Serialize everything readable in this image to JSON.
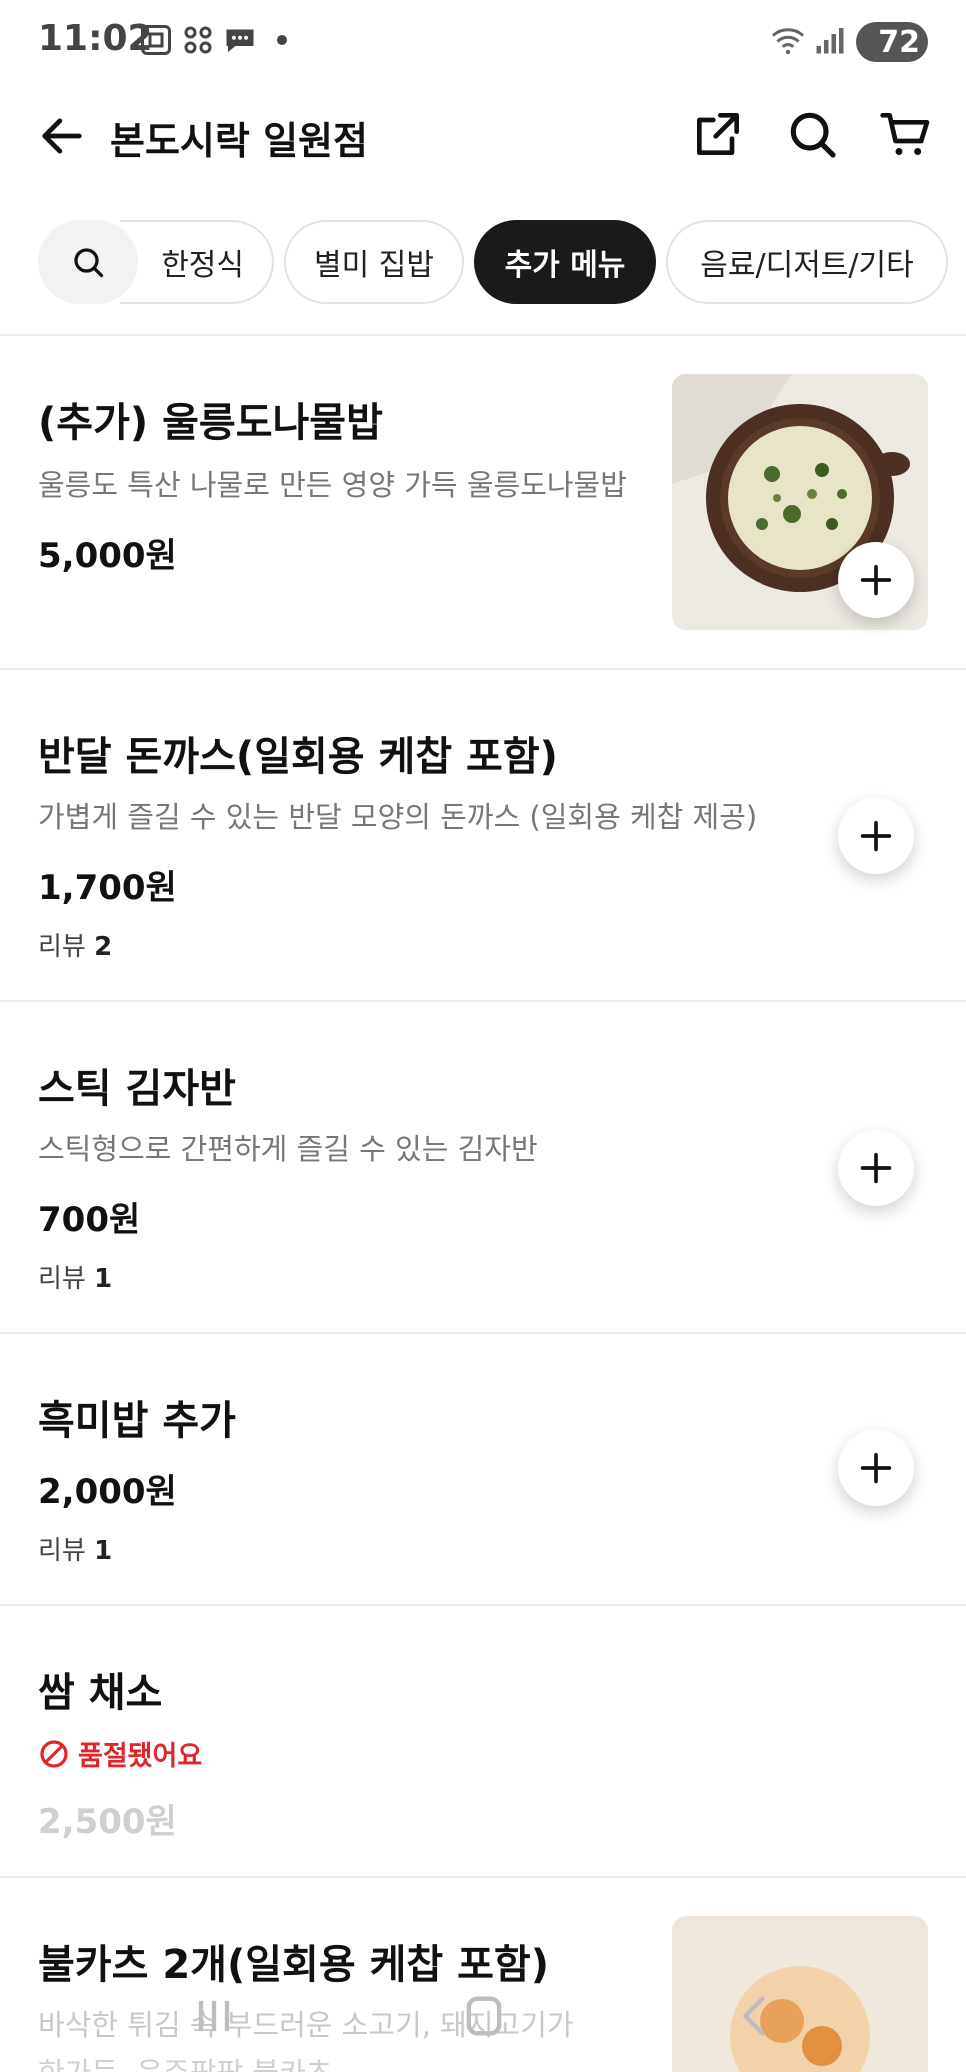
{
  "status_bar": {
    "time": "11:02",
    "battery": "72"
  },
  "header": {
    "title": "본도시락 일원점"
  },
  "tabs": [
    {
      "label": "한정식"
    },
    {
      "label": "별미 집밥"
    },
    {
      "label": "추가 메뉴"
    },
    {
      "label": "음료/디저트/기타"
    }
  ],
  "active_tab": "추가 메뉴",
  "items": [
    {
      "name": "(추가) 울릉도나물밥",
      "desc": "울릉도 특산 나물로 만든 영양 가득 울릉도나물밥",
      "price": "5,000원"
    },
    {
      "name": "반달 돈까스(일회용 케찹 포함)",
      "desc": "가볍게 즐길 수 있는 반달 모양의 돈까스 (일회용 케찹 제공)",
      "price": "1,700원",
      "review_label": "리뷰",
      "review_count": "2"
    },
    {
      "name": "스틱 김자반",
      "desc": "스틱형으로 간편하게 즐길 수 있는 김자반",
      "price": "700원",
      "review_label": "리뷰",
      "review_count": "1"
    },
    {
      "name": "흑미밥 추가",
      "price": "2,000원",
      "review_label": "리뷰",
      "review_count": "1"
    },
    {
      "name": "쌈 채소",
      "soldout": "품절됐어요",
      "price": "2,500원"
    },
    {
      "name": "불카츠 2개(일회용 케찹 포함)",
      "desc": "바삭한 튀김 속 부드러운 소고기, 돼지고기가",
      "desc2": "한가득, 음주팡팡 불카츠"
    }
  ],
  "colors": {
    "accent": "#1a1a1a",
    "soldout": "#e0262b",
    "muted": "#777777"
  }
}
